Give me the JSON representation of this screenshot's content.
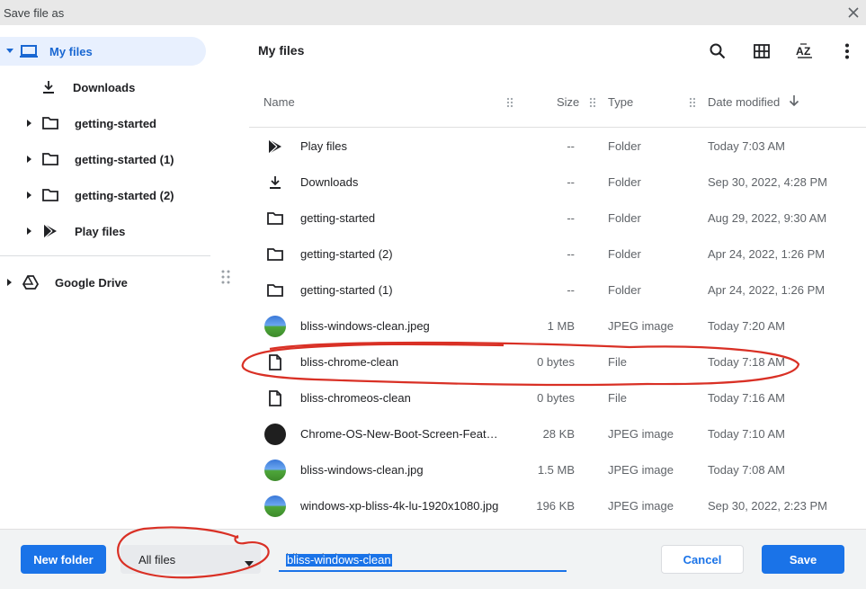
{
  "titlebar": {
    "title": "Save file as"
  },
  "sidebar": {
    "my_files": "My files",
    "items": [
      {
        "label": "Downloads"
      },
      {
        "label": "getting-started"
      },
      {
        "label": "getting-started (1)"
      },
      {
        "label": "getting-started (2)"
      },
      {
        "label": "Play files"
      }
    ],
    "google_drive": "Google Drive"
  },
  "main": {
    "breadcrumb": "My files",
    "columns": {
      "name": "Name",
      "size": "Size",
      "type": "Type",
      "date": "Date modified"
    },
    "rows": [
      {
        "name": "Play files",
        "size": "--",
        "type": "Folder",
        "date": "Today 7:03 AM",
        "icon": "play-icon"
      },
      {
        "name": "Downloads",
        "size": "--",
        "type": "Folder",
        "date": "Sep 30, 2022, 4:28 PM",
        "icon": "download-icon"
      },
      {
        "name": "getting-started",
        "size": "--",
        "type": "Folder",
        "date": "Aug 29, 2022, 9:30 AM",
        "icon": "folder-icon"
      },
      {
        "name": "getting-started (2)",
        "size": "--",
        "type": "Folder",
        "date": "Apr 24, 2022, 1:26 PM",
        "icon": "folder-icon"
      },
      {
        "name": "getting-started (1)",
        "size": "--",
        "type": "Folder",
        "date": "Apr 24, 2022, 1:26 PM",
        "icon": "folder-icon"
      },
      {
        "name": "bliss-windows-clean.jpeg",
        "size": "1 MB",
        "type": "JPEG image",
        "date": "Today 7:20 AM",
        "icon": "image-thumbnail"
      },
      {
        "name": "bliss-chrome-clean",
        "size": "0 bytes",
        "type": "File",
        "date": "Today 7:18 AM",
        "icon": "file-icon"
      },
      {
        "name": "bliss-chromeos-clean",
        "size": "0 bytes",
        "type": "File",
        "date": "Today 7:16 AM",
        "icon": "file-icon"
      },
      {
        "name": "Chrome-OS-New-Boot-Screen-Featu...",
        "size": "28 KB",
        "type": "JPEG image",
        "date": "Today 7:10 AM",
        "icon": "image-thumbnail-dark"
      },
      {
        "name": "bliss-windows-clean.jpg",
        "size": "1.5 MB",
        "type": "JPEG image",
        "date": "Today 7:08 AM",
        "icon": "image-thumbnail"
      },
      {
        "name": "windows-xp-bliss-4k-lu-1920x1080.jpg",
        "size": "196 KB",
        "type": "JPEG image",
        "date": "Sep 30, 2022, 2:23 PM",
        "icon": "image-thumbnail"
      }
    ]
  },
  "footer": {
    "new_folder": "New folder",
    "file_type_selected": "All files",
    "filename_value": "bliss-windows-clean",
    "cancel": "Cancel",
    "save": "Save"
  },
  "colors": {
    "accent": "#1a73e8",
    "selected_bg": "#e8f0fe",
    "annotation": "#d93025"
  }
}
